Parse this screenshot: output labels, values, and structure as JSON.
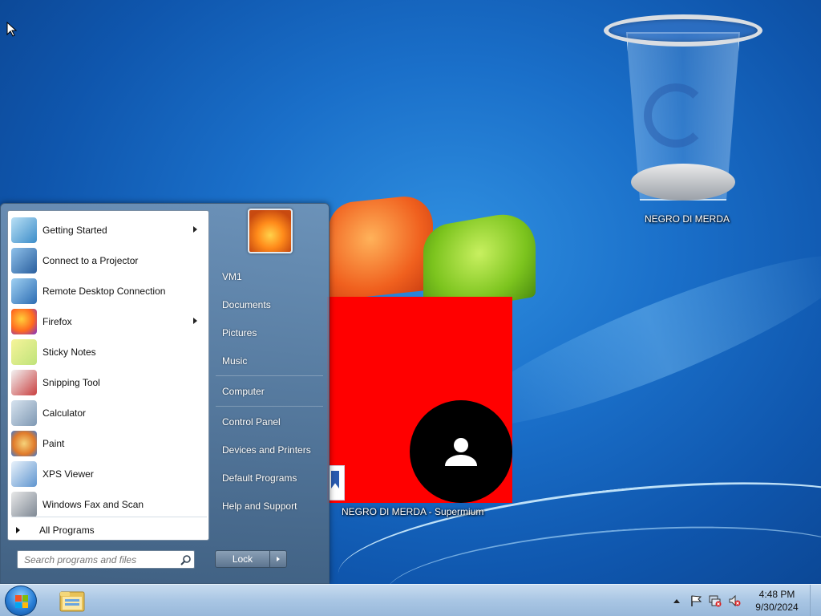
{
  "desktop": {
    "recycle_bin_label": "NEGRO DI MERDA",
    "window_label": "NEGRO DI MERDA - Supermium"
  },
  "start_menu": {
    "programs": [
      {
        "label": "Getting Started",
        "icon": "getting-started-icon",
        "submenu": true
      },
      {
        "label": "Connect to a Projector",
        "icon": "projector-icon",
        "submenu": false
      },
      {
        "label": "Remote Desktop Connection",
        "icon": "remote-desktop-icon",
        "submenu": false
      },
      {
        "label": "Firefox",
        "icon": "firefox-icon",
        "submenu": true
      },
      {
        "label": "Sticky Notes",
        "icon": "sticky-notes-icon",
        "submenu": false
      },
      {
        "label": "Snipping Tool",
        "icon": "snipping-tool-icon",
        "submenu": false
      },
      {
        "label": "Calculator",
        "icon": "calculator-icon",
        "submenu": false
      },
      {
        "label": "Paint",
        "icon": "paint-icon",
        "submenu": false
      },
      {
        "label": "XPS Viewer",
        "icon": "xps-viewer-icon",
        "submenu": false
      },
      {
        "label": "Windows Fax and Scan",
        "icon": "fax-scan-icon",
        "submenu": false
      }
    ],
    "all_programs": "All Programs",
    "search_placeholder": "Search programs and files",
    "right": {
      "user": "VM1",
      "documents": "Documents",
      "pictures": "Pictures",
      "music": "Music",
      "computer": "Computer",
      "control_panel": "Control Panel",
      "devices_printers": "Devices and Printers",
      "default_programs": "Default Programs",
      "help_support": "Help and Support"
    },
    "lock_label": "Lock"
  },
  "taskbar": {
    "time": "4:48 PM",
    "date": "9/30/2024"
  },
  "colors": {
    "accent_red": "#ff0000",
    "wallpaper_blue": "#1a6fc9"
  }
}
